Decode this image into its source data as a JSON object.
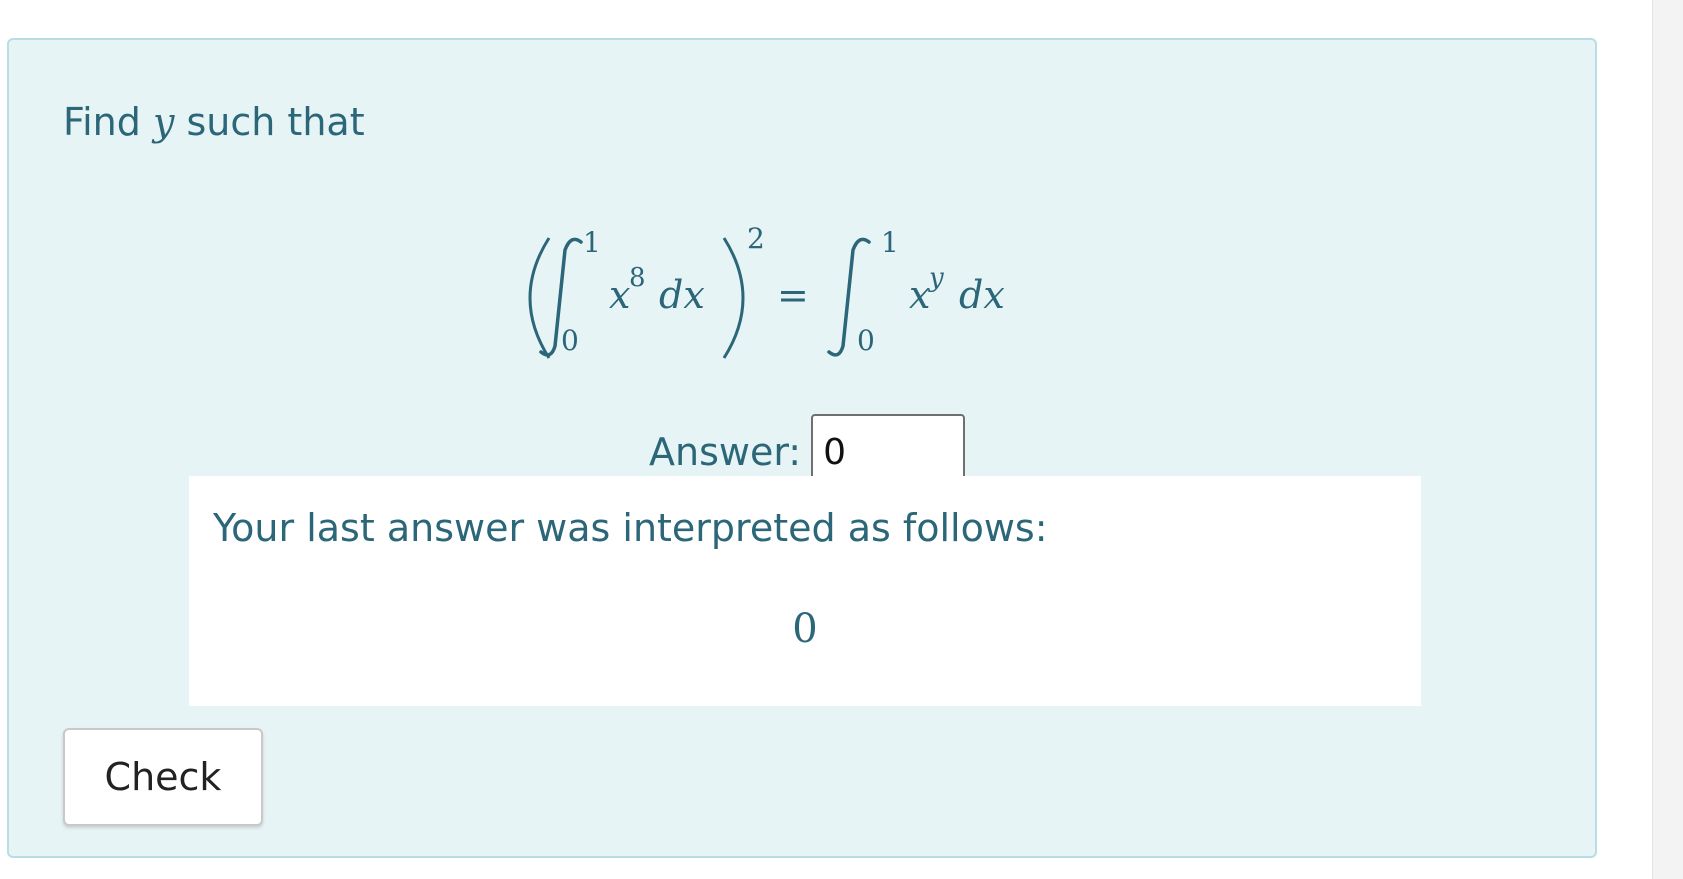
{
  "question": {
    "prompt_before": "Find ",
    "prompt_var": "y",
    "prompt_after": " such that",
    "equation": {
      "lower_limit_left": "0",
      "upper_limit_left": "1",
      "integrand_base_left": "x",
      "integrand_exp_left": "8",
      "differential_left": "dx",
      "outer_exponent": "2",
      "equals": "=",
      "lower_limit_right": "0",
      "upper_limit_right": "1",
      "integrand_base_right": "x",
      "integrand_exp_right": "y",
      "differential_right": "dx"
    },
    "answer_label": "Answer:",
    "answer_value": "0"
  },
  "feedback": {
    "text": "Your last answer was interpreted as follows:",
    "interpreted_value": "0"
  },
  "check_button": {
    "label": "Check"
  },
  "colors": {
    "card_background": "#e7f4f6",
    "card_border": "#b9dde4",
    "text": "#2b6679"
  }
}
